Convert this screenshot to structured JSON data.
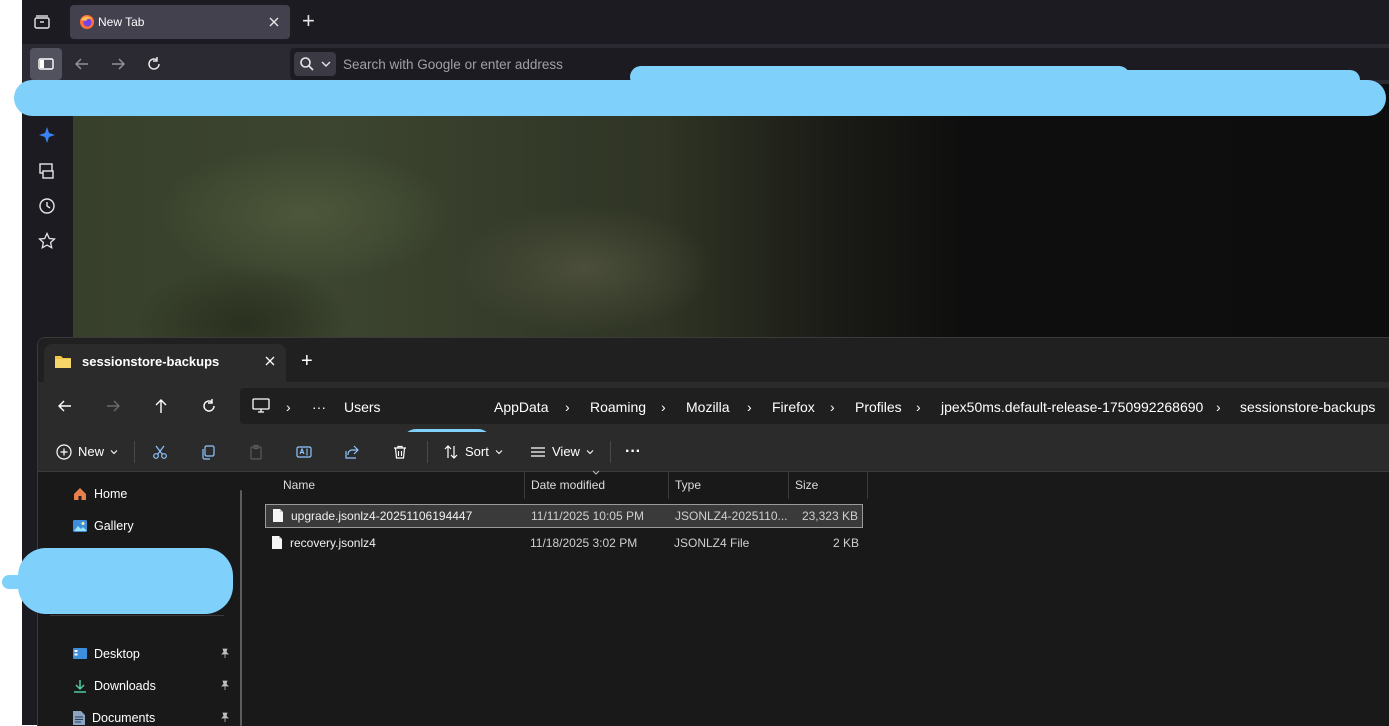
{
  "browser": {
    "tab_title": "New Tab",
    "new_tab_symbol": "+",
    "urlbar_placeholder": "Search with Google or enter address",
    "icons": [
      "tab-manager-icon",
      "firefox-icon",
      "close-icon",
      "sidebar-toggle-icon",
      "back-icon",
      "forward-icon",
      "reload-icon",
      "search-icon",
      "chevron-down-icon",
      "ai-chatbot-icon",
      "synced-tabs-icon",
      "history-icon",
      "bookmarks-icon"
    ],
    "accent": "#3b82f6"
  },
  "explorer": {
    "window_tab_title": "sessionstore-backups",
    "new_tab_symbol": "+",
    "breadcrumb": {
      "more": "···",
      "users": "Users",
      "items": [
        "AppData",
        "Roaming",
        "Mozilla",
        "Firefox",
        "Profiles",
        "jpex50ms.default-release-1750992268690",
        "sessionstore-backups"
      ]
    },
    "command_bar": {
      "new_label": "New",
      "sort_label": "Sort",
      "view_label": "View",
      "more_label": "···"
    },
    "nav": {
      "home": "Home",
      "gallery": "Gallery",
      "desktop": "Desktop",
      "downloads": "Downloads",
      "documents": "Documents"
    },
    "columns": {
      "name": "Name",
      "date": "Date modified",
      "type": "Type",
      "size": "Size"
    },
    "files": [
      {
        "name": "upgrade.jsonlz4-20251106194447",
        "date": "11/11/2025 10:05 PM",
        "type": "JSONLZ4-2025110...",
        "size": "23,323 KB",
        "selected": true
      },
      {
        "name": "recovery.jsonlz4",
        "date": "11/18/2025 3:02 PM",
        "type": "JSONLZ4 File",
        "size": "2 KB",
        "selected": false
      }
    ],
    "folder_color": "#f3c343"
  },
  "redaction_color": "#7fd1fb"
}
